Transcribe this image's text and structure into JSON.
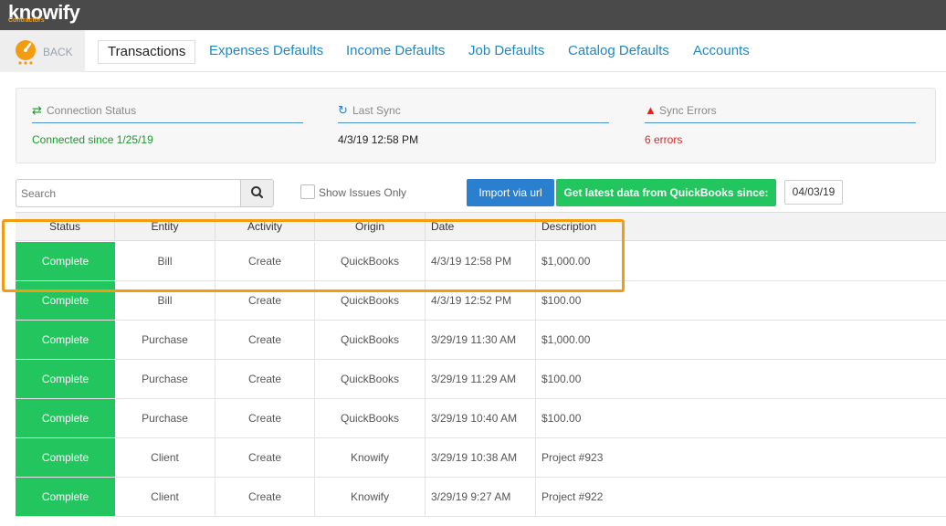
{
  "app": {
    "logo_text": "knowify",
    "logo_sub": "Contractors"
  },
  "nav": {
    "back_label": "BACK",
    "tabs": [
      {
        "label": "Transactions",
        "active": true
      },
      {
        "label": "Expenses Defaults"
      },
      {
        "label": "Income Defaults"
      },
      {
        "label": "Job Defaults"
      },
      {
        "label": "Catalog Defaults"
      },
      {
        "label": "Accounts"
      }
    ]
  },
  "status": {
    "connection": {
      "label": "Connection Status",
      "value": "Connected since 1/25/19",
      "icon": "arrows-exchange-icon",
      "color": "#1a9a2a"
    },
    "last_sync": {
      "label": "Last Sync",
      "value": "4/3/19 12:58 PM",
      "icon": "refresh-icon",
      "color": "#222222"
    },
    "sync_errors": {
      "label": "Sync Errors",
      "value": "6 errors",
      "icon": "warning-icon",
      "color": "#e02424"
    }
  },
  "toolbar": {
    "search_placeholder": "Search",
    "show_issues_label": "Show Issues Only",
    "import_label": "Import via url",
    "latest_label": "Get latest data from QuickBooks since:",
    "since_date": "04/03/19"
  },
  "table": {
    "columns": [
      "Status",
      "Entity",
      "Activity",
      "Origin",
      "Date",
      "Description"
    ],
    "rows": [
      {
        "status": "Complete",
        "entity": "Bill",
        "activity": "Create",
        "origin": "QuickBooks",
        "date": "4/3/19 12:58 PM",
        "description": "$1,000.00"
      },
      {
        "status": "Complete",
        "entity": "Bill",
        "activity": "Create",
        "origin": "QuickBooks",
        "date": "4/3/19 12:52 PM",
        "description": "$100.00"
      },
      {
        "status": "Complete",
        "entity": "Purchase",
        "activity": "Create",
        "origin": "QuickBooks",
        "date": "3/29/19 11:30 AM",
        "description": "$1,000.00"
      },
      {
        "status": "Complete",
        "entity": "Purchase",
        "activity": "Create",
        "origin": "QuickBooks",
        "date": "3/29/19 11:29 AM",
        "description": "$100.00"
      },
      {
        "status": "Complete",
        "entity": "Purchase",
        "activity": "Create",
        "origin": "QuickBooks",
        "date": "3/29/19 10:40 AM",
        "description": "$100.00"
      },
      {
        "status": "Complete",
        "entity": "Client",
        "activity": "Create",
        "origin": "Knowify",
        "date": "3/29/19 10:38 AM",
        "description": "Project #923"
      },
      {
        "status": "Complete",
        "entity": "Client",
        "activity": "Create",
        "origin": "Knowify",
        "date": "3/29/19 9:27 AM",
        "description": "Project #922"
      }
    ]
  },
  "colors": {
    "accent": "#1e88c7",
    "complete_green": "#22c55e",
    "highlight_orange": "#f39c12"
  }
}
